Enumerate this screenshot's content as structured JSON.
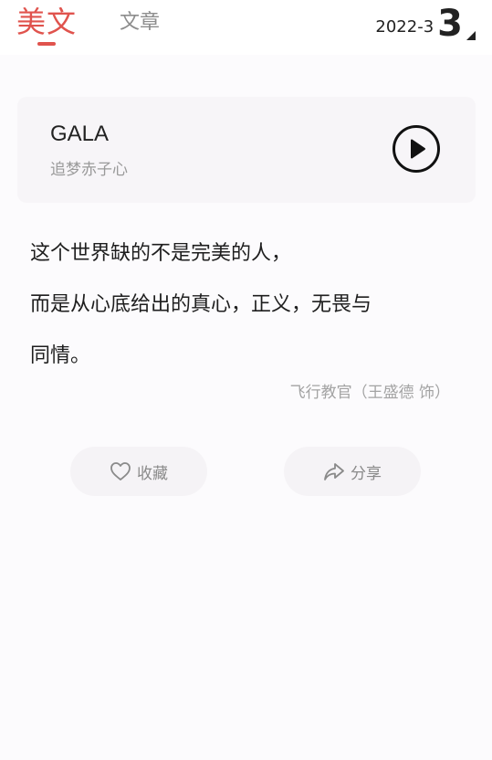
{
  "header": {
    "active_tab": "美文",
    "inactive_tab": "文章",
    "date_month": "2022-3",
    "date_day": "3"
  },
  "music": {
    "title": "GALA",
    "subtitle": "追梦赤子心",
    "play_icon": "play-circle-icon"
  },
  "quote": {
    "lines": [
      "这个世界缺的不是完美的人，",
      "而是从心底给出的真心，正义，无畏与",
      "同情。"
    ],
    "source": "飞行教官（王盛德 饰）"
  },
  "actions": {
    "collect_label": "收藏",
    "collect_icon": "heart-outline-icon",
    "share_label": "分享",
    "share_icon": "share-arrow-icon"
  },
  "colors": {
    "accent": "#e0534d",
    "card_bg": "#f7f5f8"
  }
}
